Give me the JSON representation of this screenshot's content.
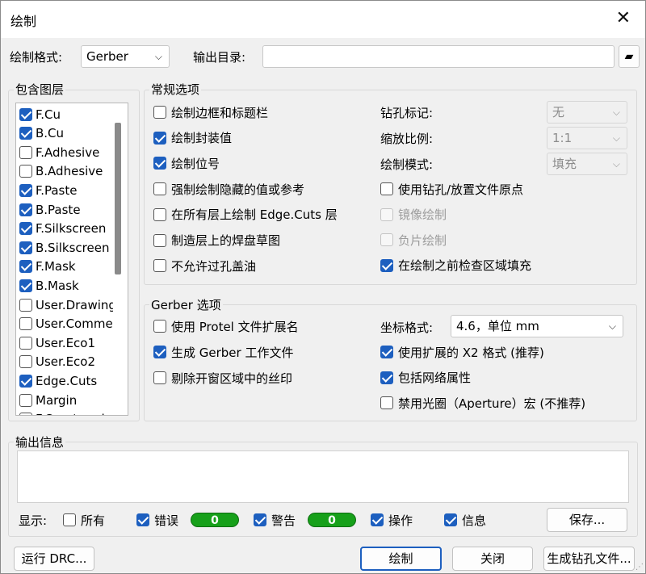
{
  "window": {
    "title": "绘制"
  },
  "top": {
    "format_label": "绘制格式:",
    "format_value": "Gerber",
    "output_dir_label": "输出目录:",
    "output_dir_value": ""
  },
  "layers": {
    "title": "包含图层",
    "items": [
      {
        "label": "F.Cu",
        "checked": true
      },
      {
        "label": "B.Cu",
        "checked": true
      },
      {
        "label": "F.Adhesive",
        "checked": false
      },
      {
        "label": "B.Adhesive",
        "checked": false
      },
      {
        "label": "F.Paste",
        "checked": true
      },
      {
        "label": "B.Paste",
        "checked": true
      },
      {
        "label": "F.Silkscreen",
        "checked": true
      },
      {
        "label": "B.Silkscreen",
        "checked": true
      },
      {
        "label": "F.Mask",
        "checked": true
      },
      {
        "label": "B.Mask",
        "checked": true
      },
      {
        "label": "User.Drawings",
        "checked": false
      },
      {
        "label": "User.Comments",
        "checked": false
      },
      {
        "label": "User.Eco1",
        "checked": false
      },
      {
        "label": "User.Eco2",
        "checked": false
      },
      {
        "label": "Edge.Cuts",
        "checked": true
      },
      {
        "label": "Margin",
        "checked": false
      },
      {
        "label": "F.Courtyard",
        "checked": false
      }
    ]
  },
  "general": {
    "title": "常规选项",
    "left": [
      {
        "label": "绘制边框和标题栏",
        "checked": false
      },
      {
        "label": "绘制封装值",
        "checked": true
      },
      {
        "label": "绘制位号",
        "checked": true
      },
      {
        "label": "强制绘制隐藏的值或参考",
        "checked": false
      },
      {
        "label": "在所有层上绘制 Edge.Cuts 层",
        "checked": false
      },
      {
        "label": "制造层上的焊盘草图",
        "checked": false
      },
      {
        "label": "不允许过孔盖油",
        "checked": false
      }
    ],
    "drill_label": "钻孔标记:",
    "drill_value": "无",
    "scale_label": "缩放比例:",
    "scale_value": "1:1",
    "mode_label": "绘制模式:",
    "mode_value": "填充",
    "right": [
      {
        "label": "使用钻孔/放置文件原点",
        "checked": false,
        "disabled": false
      },
      {
        "label": "镜像绘制",
        "checked": false,
        "disabled": true
      },
      {
        "label": "负片绘制",
        "checked": false,
        "disabled": true
      },
      {
        "label": "在绘制之前检查区域填充",
        "checked": true,
        "disabled": false
      }
    ]
  },
  "gerber": {
    "title": "Gerber 选项",
    "left": [
      {
        "label": "使用 Protel 文件扩展名",
        "checked": false
      },
      {
        "label": "生成 Gerber 工作文件",
        "checked": true
      },
      {
        "label": "剔除开窗区域中的丝印",
        "checked": false
      }
    ],
    "coord_label": "坐标格式:",
    "coord_value": "4.6，单位 mm",
    "right": [
      {
        "label": "使用扩展的 X2 格式 (推荐)",
        "checked": true
      },
      {
        "label": "包括网络属性",
        "checked": true
      },
      {
        "label": "禁用光圈（Aperture）宏 (不推荐)",
        "checked": false
      }
    ]
  },
  "output": {
    "title": "输出信息",
    "show_label": "显示:",
    "all_label": "所有",
    "errors_label": "错误",
    "errors_count": "0",
    "warnings_label": "警告",
    "warnings_count": "0",
    "actions_label": "操作",
    "info_label": "信息",
    "save_label": "保存..."
  },
  "footer": {
    "run_drc": "运行 DRC...",
    "plot": "绘制",
    "close": "关闭",
    "gen_drill": "生成钻孔文件..."
  },
  "colors": {
    "accent": "#1d5fbf",
    "badge": "#17a01a"
  }
}
